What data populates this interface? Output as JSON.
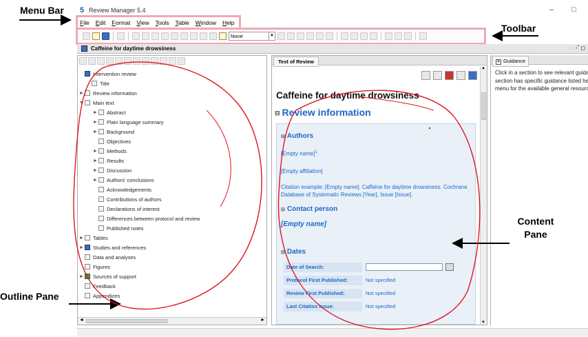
{
  "window": {
    "title": "Review Manager 5.4",
    "app_icon": "5",
    "minimize": "–",
    "maximize": "□"
  },
  "menu": [
    "File",
    "Edit",
    "Format",
    "View",
    "Tools",
    "Table",
    "Window",
    "Help"
  ],
  "toolbar": {
    "style_select": "None",
    "style_arrow": "▼"
  },
  "document": {
    "title": "Caffeine for daytime drowsiness",
    "dock_control": "◦ˆ ◻"
  },
  "outline": {
    "items": [
      {
        "label": "Intervention review",
        "level": 0,
        "expander": "",
        "icon": "blue"
      },
      {
        "label": "Title",
        "level": 1,
        "expander": "",
        "icon": "page"
      },
      {
        "label": "Review information",
        "level": 0,
        "expander": "►",
        "icon": "page"
      },
      {
        "label": "Main text",
        "level": 0,
        "expander": "▼",
        "icon": "page"
      },
      {
        "label": "Abstract",
        "level": 2,
        "expander": "►",
        "icon": "page"
      },
      {
        "label": "Plain language summary",
        "level": 2,
        "expander": "►",
        "icon": "page"
      },
      {
        "label": "Background",
        "level": 2,
        "expander": "►",
        "icon": "page"
      },
      {
        "label": "Objectives",
        "level": 2,
        "expander": "",
        "icon": "page"
      },
      {
        "label": "Methods",
        "level": 2,
        "expander": "►",
        "icon": "page"
      },
      {
        "label": "Results",
        "level": 2,
        "expander": "►",
        "icon": "page"
      },
      {
        "label": "Discussion",
        "level": 2,
        "expander": "►",
        "icon": "page"
      },
      {
        "label": "Authors' conclusions",
        "level": 2,
        "expander": "►",
        "icon": "page"
      },
      {
        "label": "Acknowledgements",
        "level": 2,
        "expander": "",
        "icon": "page"
      },
      {
        "label": "Contributions of authors",
        "level": 2,
        "expander": "",
        "icon": "page"
      },
      {
        "label": "Declarations of interest",
        "level": 2,
        "expander": "",
        "icon": "page"
      },
      {
        "label": "Differences between protocol and review",
        "level": 2,
        "expander": "",
        "icon": "page"
      },
      {
        "label": "Published notes",
        "level": 2,
        "expander": "",
        "icon": "page"
      },
      {
        "label": "Tables",
        "level": 0,
        "expander": "►",
        "icon": "page"
      },
      {
        "label": "Studies and references",
        "level": 0,
        "expander": "►",
        "icon": "blue"
      },
      {
        "label": "Data and analyses",
        "level": 0,
        "expander": "",
        "icon": "page"
      },
      {
        "label": "Figures",
        "level": 0,
        "expander": "",
        "icon": "page"
      },
      {
        "label": "Sources of support",
        "level": 0,
        "expander": "►",
        "icon": "green"
      },
      {
        "label": "Feedback",
        "level": 0,
        "expander": "",
        "icon": "page"
      },
      {
        "label": "Appendices",
        "level": 0,
        "expander": "",
        "icon": "page"
      }
    ],
    "scroll_left": "◄",
    "scroll_right": "►"
  },
  "content": {
    "tab": "Text of Review",
    "doc_title": "Caffeine for daytime drowsiness",
    "section": "Review information",
    "section_marker": "⊟",
    "authors_heading": "Authors",
    "empty_name_link": "[Empty name]",
    "superscript": "1",
    "empty_affiliation": "[Empty affiliation]",
    "citation": "Citation example: [Empty name]. Caffeine for daytime drowsiness. Cochrane Database of Systematic Reviews [Year], Issue [Issue].",
    "contact_heading": "Contact person",
    "contact_name": "[Empty name]",
    "dates_heading": "Dates",
    "dates": [
      {
        "label": "Date of Search:",
        "value": ""
      },
      {
        "label": "Protocol First Published:",
        "value": "Not specified"
      },
      {
        "label": "Review First Published:",
        "value": "Not specified"
      },
      {
        "label": "Last Citation Issue:",
        "value": "Not specified"
      }
    ],
    "scroll_up": "▲",
    "scroll_down": "▼"
  },
  "guidance": {
    "tab": "Guidance",
    "close": "✕",
    "text": "Click in a section to see relevant guidance. Not every section has specific guidance listed here - see the Help menu for the available general resources."
  },
  "annotations": {
    "menu_bar": "Menu Bar",
    "toolbar": "Toolbar",
    "content_pane_line1": "Content",
    "content_pane_line2": "Pane",
    "outline_pane": "Outline Pane"
  },
  "colors": {
    "link_blue": "#1b68c4",
    "highlight_pink": "#f2a7b4",
    "scribble_red": "#e0141e"
  }
}
